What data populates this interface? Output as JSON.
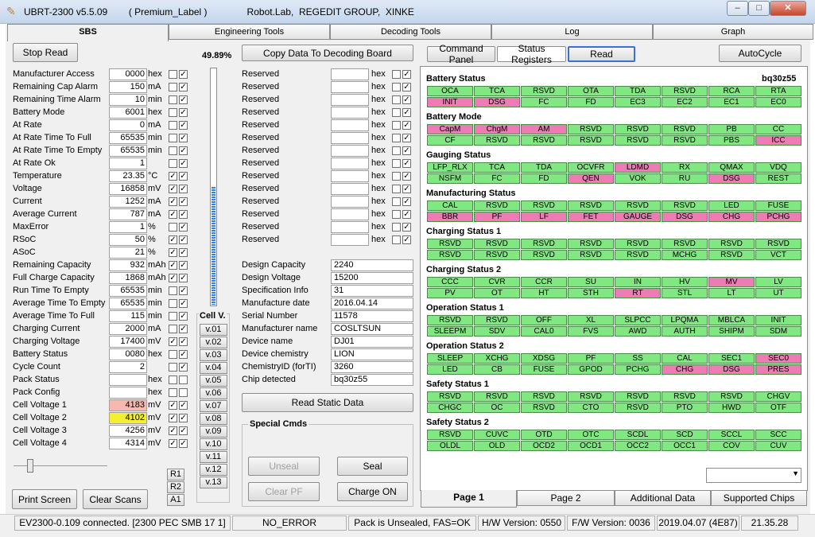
{
  "window": {
    "title": "UBRT-2300 v5.5.09        ( Premium_Label )               Robot.Lab,  REGEDIT GROUP,  XINKE",
    "min": "–",
    "max": "□",
    "close": "✕"
  },
  "tabs": [
    "SBS",
    "Engineering Tools",
    "Decoding Tools",
    "Log",
    "Graph"
  ],
  "left": {
    "stop_read": "Stop Read",
    "percent": "49.89%",
    "copy_button": "Copy Data To Decoding Board",
    "sbs_rows": [
      {
        "label": "Manufacturer Access",
        "value": "0000",
        "unit": "hex",
        "c1": "",
        "c2": "✓"
      },
      {
        "label": "Remaining Cap Alarm",
        "value": "150",
        "unit": "mA",
        "c1": "",
        "c2": "✓"
      },
      {
        "label": "Remaining Time Alarm",
        "value": "10",
        "unit": "min",
        "c1": "",
        "c2": "✓"
      },
      {
        "label": "Battery Mode",
        "value": "6001",
        "unit": "hex",
        "c1": "",
        "c2": "✓"
      },
      {
        "label": "At Rate",
        "value": "0",
        "unit": "mA",
        "c1": "",
        "c2": "✓"
      },
      {
        "label": "At Rate Time To Full",
        "value": "65535",
        "unit": "min",
        "c1": "",
        "c2": "✓"
      },
      {
        "label": "At Rate Time To Empty",
        "value": "65535",
        "unit": "min",
        "c1": "",
        "c2": "✓"
      },
      {
        "label": "At Rate Ok",
        "value": "1",
        "unit": "",
        "c1": "",
        "c2": "✓"
      },
      {
        "label": "Temperature",
        "value": "23.35",
        "unit": "°C",
        "c1": "✓",
        "c2": "✓"
      },
      {
        "label": "Voltage",
        "value": "16858",
        "unit": "mV",
        "c1": "✓",
        "c2": "✓"
      },
      {
        "label": "Current",
        "value": "1252",
        "unit": "mA",
        "c1": "✓",
        "c2": "✓"
      },
      {
        "label": "Average Current",
        "value": "787",
        "unit": "mA",
        "c1": "✓",
        "c2": "✓"
      },
      {
        "label": "MaxError",
        "value": "1",
        "unit": "%",
        "c1": "",
        "c2": "✓"
      },
      {
        "label": "RSoC",
        "value": "50",
        "unit": "%",
        "c1": "✓",
        "c2": "✓"
      },
      {
        "label": "ASoC",
        "value": "21",
        "unit": "%",
        "c1": "✓",
        "c2": "✓"
      },
      {
        "label": "Remaining Capacity",
        "value": "932",
        "unit": "mAh",
        "c1": "✓",
        "c2": "✓"
      },
      {
        "label": "Full Charge Capacity",
        "value": "1868",
        "unit": "mAh",
        "c1": "✓",
        "c2": "✓"
      },
      {
        "label": "Run Time To Empty",
        "value": "65535",
        "unit": "min",
        "c1": "",
        "c2": "✓"
      },
      {
        "label": "Average Time To Empty",
        "value": "65535",
        "unit": "min",
        "c1": "",
        "c2": "✓"
      },
      {
        "label": "Average Time To Full",
        "value": "115",
        "unit": "min",
        "c1": "",
        "c2": "✓"
      },
      {
        "label": "Charging Current",
        "value": "2000",
        "unit": "mA",
        "c1": "",
        "c2": "✓"
      },
      {
        "label": "Charging Voltage",
        "value": "17400",
        "unit": "mV",
        "c1": "✓",
        "c2": "✓"
      },
      {
        "label": "Battery Status",
        "value": "0080",
        "unit": "hex",
        "c1": "",
        "c2": "✓"
      },
      {
        "label": "Cycle Count",
        "value": "2",
        "unit": "",
        "c1": "",
        "c2": "✓"
      },
      {
        "label": "Pack Status",
        "value": "",
        "unit": "hex",
        "c1": "",
        "c2": ""
      },
      {
        "label": "Pack Config",
        "value": "",
        "unit": "hex",
        "c1": "",
        "c2": ""
      },
      {
        "label": "Cell Voltage 1",
        "value": "4183",
        "unit": "mV",
        "c1": "✓",
        "c2": "✓",
        "bg": "#f8b8b0"
      },
      {
        "label": "Cell Voltage 2",
        "value": "4102",
        "unit": "mV",
        "c1": "✓",
        "c2": "✓",
        "bg": "#f4f030"
      },
      {
        "label": "Cell Voltage 3",
        "value": "4256",
        "unit": "mV",
        "c1": "✓",
        "c2": "✓"
      },
      {
        "label": "Cell Voltage 4",
        "value": "4314",
        "unit": "mV",
        "c1": "✓",
        "c2": "✓"
      }
    ],
    "soc_level": 0.4989,
    "cellv_title": "Cell V.",
    "cellv_buttons": [
      "v.01",
      "v.02",
      "v.03",
      "v.04",
      "v.05",
      "v.06",
      "v.07",
      "v.08",
      "v.09",
      "v.10",
      "v.11",
      "v.12",
      "v.13"
    ],
    "r_buttons": [
      "R1",
      "R2",
      "A1"
    ],
    "print_screen": "Print Screen",
    "clear_scans": "Clear Scans"
  },
  "middle": {
    "reserved_rows": [
      {
        "label": "Reserved",
        "unit": "hex",
        "c2": "✓"
      },
      {
        "label": "Reserved",
        "unit": "hex",
        "c2": "✓"
      },
      {
        "label": "Reserved",
        "unit": "hex",
        "c2": "✓"
      },
      {
        "label": "Reserved",
        "unit": "hex",
        "c2": "✓"
      },
      {
        "label": "Reserved",
        "unit": "hex",
        "c2": "✓"
      },
      {
        "label": "Reserved",
        "unit": "hex",
        "c2": "✓"
      },
      {
        "label": "Reserved",
        "unit": "hex",
        "c2": "✓"
      },
      {
        "label": "Reserved",
        "unit": "hex",
        "c2": "✓"
      },
      {
        "label": "Reserved",
        "unit": "hex",
        "c2": "✓"
      },
      {
        "label": "Reserved",
        "unit": "hex",
        "c2": "✓"
      },
      {
        "label": "Reserved",
        "unit": "hex",
        "c2": "✓"
      },
      {
        "label": "Reserved",
        "unit": "hex",
        "c2": "✓"
      },
      {
        "label": "Reserved",
        "unit": "hex",
        "c2": "✓"
      },
      {
        "label": "Reserved",
        "unit": "hex",
        "c2": "✓"
      }
    ],
    "static_rows": [
      {
        "label": "Design Capacity",
        "value": "2240"
      },
      {
        "label": "Design Voltage",
        "value": "15200"
      },
      {
        "label": "Specification Info",
        "value": "31"
      },
      {
        "label": "Manufacture date",
        "value": "2016.04.14"
      },
      {
        "label": "Serial Number",
        "value": "11578"
      },
      {
        "label": "Manufacturer name",
        "value": "COSLTSUN"
      },
      {
        "label": "Device name",
        "value": "DJ01"
      },
      {
        "label": "Device chemistry",
        "value": "LION"
      },
      {
        "label": "ChemistryID (forTI)",
        "value": "3260"
      },
      {
        "label": "Chip detected",
        "value": "bq30z55"
      }
    ],
    "read_static": "Read Static Data",
    "special_title": "Special Cmds",
    "unseal": "Unseal",
    "seal": "Seal",
    "clear_pf": "Clear PF",
    "charge_on": "Charge ON"
  },
  "right": {
    "command_panel": "Command Panel",
    "status_registers": "Status Registers",
    "read": "Read",
    "autocycle": "AutoCycle",
    "chip": "bq30z55",
    "registers": [
      {
        "title": "Battery Status",
        "rows": [
          [
            "OCA",
            "TCA",
            "RSVD",
            "OTA",
            "TDA",
            "RSVD",
            "RCA",
            "RTA"
          ],
          [
            "INIT",
            "DSG",
            "FC",
            "FD",
            "EC3",
            "EC2",
            "EC1",
            "EC0"
          ]
        ],
        "pink": [
          [],
          [
            0,
            1
          ]
        ]
      },
      {
        "title": "Battery Mode",
        "rows": [
          [
            "CapM",
            "ChgM",
            "AM",
            "RSVD",
            "RSVD",
            "RSVD",
            "PB",
            "CC"
          ],
          [
            "CF",
            "RSVD",
            "RSVD",
            "RSVD",
            "RSVD",
            "RSVD",
            "PBS",
            "ICC"
          ]
        ],
        "pink": [
          [
            0,
            1,
            2
          ],
          [
            7
          ]
        ]
      },
      {
        "title": "Gauging Status",
        "rows": [
          [
            "LFP_RLX",
            "TCA",
            "TDA",
            "OCVFR",
            "LDMD",
            "RX",
            "QMAX",
            "VDQ"
          ],
          [
            "NSFM",
            "FC",
            "FD",
            "QEN",
            "VOK",
            "RU",
            "DSG",
            "REST"
          ]
        ],
        "pink": [
          [
            4
          ],
          [
            3,
            6
          ]
        ]
      },
      {
        "title": "Manufacturing Status",
        "rows": [
          [
            "CAL",
            "RSVD",
            "RSVD",
            "RSVD",
            "RSVD",
            "RSVD",
            "LED",
            "FUSE"
          ],
          [
            "BBR",
            "PF",
            "LF",
            "FET",
            "GAUGE",
            "DSG",
            "CHG",
            "PCHG"
          ]
        ],
        "pink": [
          [],
          [
            0,
            1,
            2,
            3,
            4,
            5,
            6,
            7
          ]
        ]
      },
      {
        "title": "Charging Status 1",
        "rows": [
          [
            "RSVD",
            "RSVD",
            "RSVD",
            "RSVD",
            "RSVD",
            "RSVD",
            "RSVD",
            "RSVD"
          ],
          [
            "RSVD",
            "RSVD",
            "RSVD",
            "RSVD",
            "RSVD",
            "MCHG",
            "RSVD",
            "VCT"
          ]
        ],
        "pink": [
          [],
          []
        ]
      },
      {
        "title": "Charging Status 2",
        "rows": [
          [
            "CCC",
            "CVR",
            "CCR",
            "SU",
            "IN",
            "HV",
            "MV",
            "LV"
          ],
          [
            "PV",
            "OT",
            "HT",
            "STH",
            "RT",
            "STL",
            "LT",
            "UT"
          ]
        ],
        "pink": [
          [
            6
          ],
          [
            4
          ]
        ]
      },
      {
        "title": "Operation Status 1",
        "rows": [
          [
            "RSVD",
            "RSVD",
            "OFF",
            "XL",
            "SLPCC",
            "LPQMA",
            "MBLCA",
            "INIT"
          ],
          [
            "SLEEPM",
            "SDV",
            "CAL0",
            "FVS",
            "AWD",
            "AUTH",
            "SHIPM",
            "SDM"
          ]
        ],
        "pink": [
          [],
          []
        ]
      },
      {
        "title": "Operation Status 2",
        "rows": [
          [
            "SLEEP",
            "XCHG",
            "XDSG",
            "PF",
            "SS",
            "CAL",
            "SEC1",
            "SEC0"
          ],
          [
            "LED",
            "CB",
            "FUSE",
            "GPOD",
            "PCHG",
            "CHG",
            "DSG",
            "PRES"
          ]
        ],
        "pink": [
          [
            7
          ],
          [
            5,
            6,
            7
          ]
        ]
      },
      {
        "title": "Safety Status 1",
        "rows": [
          [
            "RSVD",
            "RSVD",
            "RSVD",
            "RSVD",
            "RSVD",
            "RSVD",
            "RSVD",
            "CHGV"
          ],
          [
            "CHGC",
            "OC",
            "RSVD",
            "CTO",
            "RSVD",
            "PTO",
            "HWD",
            "OTF"
          ]
        ],
        "pink": [
          [],
          []
        ]
      },
      {
        "title": "Safety Status 2",
        "rows": [
          [
            "RSVD",
            "CUVC",
            "OTD",
            "OTC",
            "SCDL",
            "SCD",
            "SCCL",
            "SCC"
          ],
          [
            "OLDL",
            "OLD",
            "OCD2",
            "OCD1",
            "OCC2",
            "OCC1",
            "COV",
            "CUV"
          ]
        ],
        "pink": [
          [],
          []
        ]
      }
    ],
    "bottom_tabs": [
      "Page 1",
      "Page 2",
      "Additional Data",
      "Supported Chips"
    ],
    "dropdown_value": ""
  },
  "statusbar": [
    "EV2300-0.109 connected. [2300  PEC  SMB  17 1]",
    "NO_ERROR",
    "Pack is Unsealed, FAS=OK",
    "H/W Version: 0550",
    "F/W Version: 0036",
    "2019.04.07  (4E87)",
    "21.35.28"
  ]
}
